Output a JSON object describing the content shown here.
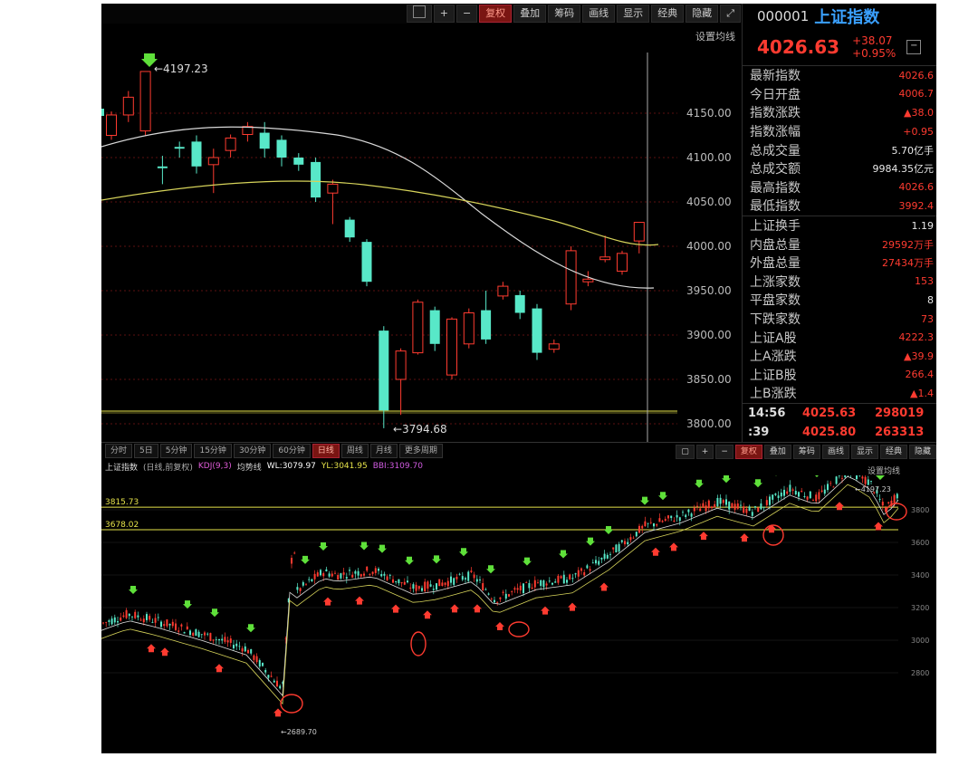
{
  "toolbar": {
    "items": [
      "+",
      "复权",
      "叠加",
      "筹码",
      "画线",
      "显示",
      "经典",
      "隐藏"
    ],
    "set_ma": "设置均线"
  },
  "main_chart": {
    "high_label": "4197.23",
    "low_label": "3794.68",
    "y_ticks": [
      "4150.00",
      "4100.00",
      "4050.00",
      "4000.00",
      "3950.00",
      "3900.00",
      "3850.00",
      "3800.00"
    ]
  },
  "right_panel": {
    "code": "000001",
    "name": "上证指数",
    "price": "4026.63",
    "change": "+38.07",
    "change_pct": "+0.95%",
    "rows": [
      {
        "k": "最新指数",
        "v": "4026.6",
        "c": "red"
      },
      {
        "k": "今日开盘",
        "v": "4006.7",
        "c": "red"
      },
      {
        "k": "指数涨跌",
        "v": "▲38.0",
        "c": "red"
      },
      {
        "k": "指数涨幅",
        "v": "+0.95",
        "c": "red"
      },
      {
        "k": "总成交量",
        "v": "5.70亿手",
        "c": "white"
      },
      {
        "k": "总成交额",
        "v": "9984.35亿元",
        "c": "white"
      },
      {
        "k": "最高指数",
        "v": "4026.6",
        "c": "red"
      },
      {
        "k": "最低指数",
        "v": "3992.4",
        "c": "red"
      },
      {
        "k": "上证换手",
        "v": "1.19",
        "c": "white"
      },
      {
        "k": "内盘总量",
        "v": "29592万手",
        "c": "red"
      },
      {
        "k": "外盘总量",
        "v": "27434万手",
        "c": "red"
      },
      {
        "k": "上涨家数",
        "v": "153",
        "c": "red"
      },
      {
        "k": "平盘家数",
        "v": "8",
        "c": "white"
      },
      {
        "k": "下跌家数",
        "v": "73",
        "c": "red"
      },
      {
        "k": "上证A股",
        "v": "4222.3",
        "c": "red"
      },
      {
        "k": "上A涨跌",
        "v": "▲39.9",
        "c": "red"
      },
      {
        "k": "上证B股",
        "v": "266.4",
        "c": "red"
      },
      {
        "k": "上B涨跌",
        "v": "▲1.4",
        "c": "red"
      }
    ],
    "ticks": [
      {
        "t": "14:56",
        "p": "4025.63",
        "q": "298019"
      },
      {
        "t": ":39",
        "p": "4025.80",
        "q": "263313"
      }
    ]
  },
  "bottom": {
    "tabs": [
      "分时",
      "5日",
      "5分钟",
      "15分钟",
      "30分钟",
      "60分钟",
      "日线",
      "周线",
      "月线",
      "更多周期"
    ],
    "active_tab": "日线",
    "toolbar": [
      "+",
      "复权",
      "叠加",
      "筹码",
      "画线",
      "显示",
      "经典",
      "隐藏"
    ],
    "info": {
      "name": "上证指数",
      "mode": "(日线,前复权)",
      "kdj": "KDJ(9,3)",
      "ma_label": "均势线",
      "wl": "WL:3079.97",
      "yl": "YL:3041.95",
      "bbi": "BBI:3109.70"
    },
    "set_ma": "设置均线",
    "level_1": "3815.73",
    "level_2": "3678.02",
    "high_label": "4197.23",
    "low_label": "2689.70",
    "y_ticks": [
      "3800",
      "3600",
      "3400",
      "3200",
      "3000",
      "2800"
    ]
  }
}
